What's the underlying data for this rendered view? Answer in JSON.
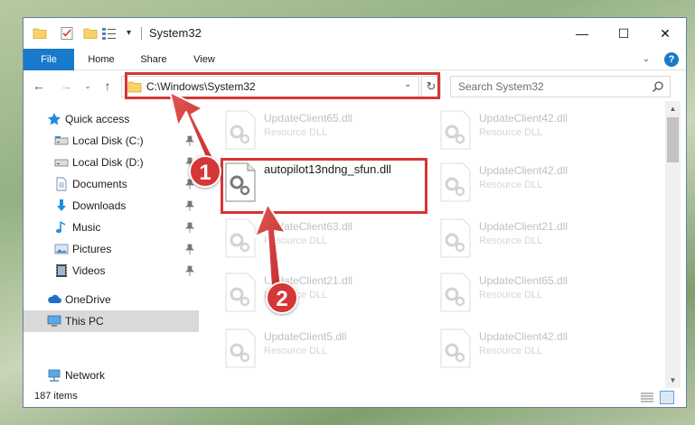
{
  "window": {
    "title": "System32",
    "controls": {
      "minimize": "—",
      "maximize": "☐",
      "close": "✕"
    }
  },
  "ribbon": {
    "tabs": [
      "File",
      "Home",
      "Share",
      "View"
    ],
    "help": "?"
  },
  "navigation": {
    "address": "C:\\Windows\\System32",
    "search_placeholder": "Search System32"
  },
  "sidebar": {
    "items": [
      {
        "label": "Quick access",
        "icon": "star-icon",
        "pinned": false
      },
      {
        "label": "Local Disk (C:)",
        "icon": "drive-icon",
        "pinned": true
      },
      {
        "label": "Local Disk (D:)",
        "icon": "drive-icon",
        "pinned": true
      },
      {
        "label": "Documents",
        "icon": "documents-icon",
        "pinned": true
      },
      {
        "label": "Downloads",
        "icon": "download-icon",
        "pinned": true
      },
      {
        "label": "Music",
        "icon": "music-icon",
        "pinned": true
      },
      {
        "label": "Pictures",
        "icon": "pictures-icon",
        "pinned": true
      },
      {
        "label": "Videos",
        "icon": "videos-icon",
        "pinned": true
      },
      {
        "label": "OneDrive",
        "icon": "cloud-icon",
        "pinned": false
      },
      {
        "label": "This PC",
        "icon": "computer-icon",
        "pinned": false,
        "selected": true
      },
      {
        "label": "Network",
        "icon": "network-icon",
        "pinned": false
      }
    ]
  },
  "content": {
    "files": [
      {
        "name": "UpdateClient65.dll",
        "type": "Resource DLL"
      },
      {
        "name": "UpdateClient42.dll",
        "type": "Resource DLL"
      },
      {
        "name": "autopilot13ndng_sfun.dll",
        "type": ""
      },
      {
        "name": "UpdateClient42.dll",
        "type": "Resource DLL"
      },
      {
        "name": "UpdateClient63.dll",
        "type": "Resource DLL"
      },
      {
        "name": "UpdateClient21.dll",
        "type": "Resource DLL"
      },
      {
        "name": "UpdateClient21.dll",
        "type": "Resource DLL"
      },
      {
        "name": "UpdateClient65.dll",
        "type": "Resource DLL"
      },
      {
        "name": "UpdateClient5.dll",
        "type": "Resource DLL"
      },
      {
        "name": "UpdateClient42.dll",
        "type": "Resource DLL"
      }
    ]
  },
  "status": {
    "item_count": "187 items"
  },
  "annotations": {
    "step1": "1",
    "step2": "2",
    "color": "#d53636"
  },
  "colors": {
    "accent": "#1979ca",
    "selection": "#cce8ff"
  }
}
